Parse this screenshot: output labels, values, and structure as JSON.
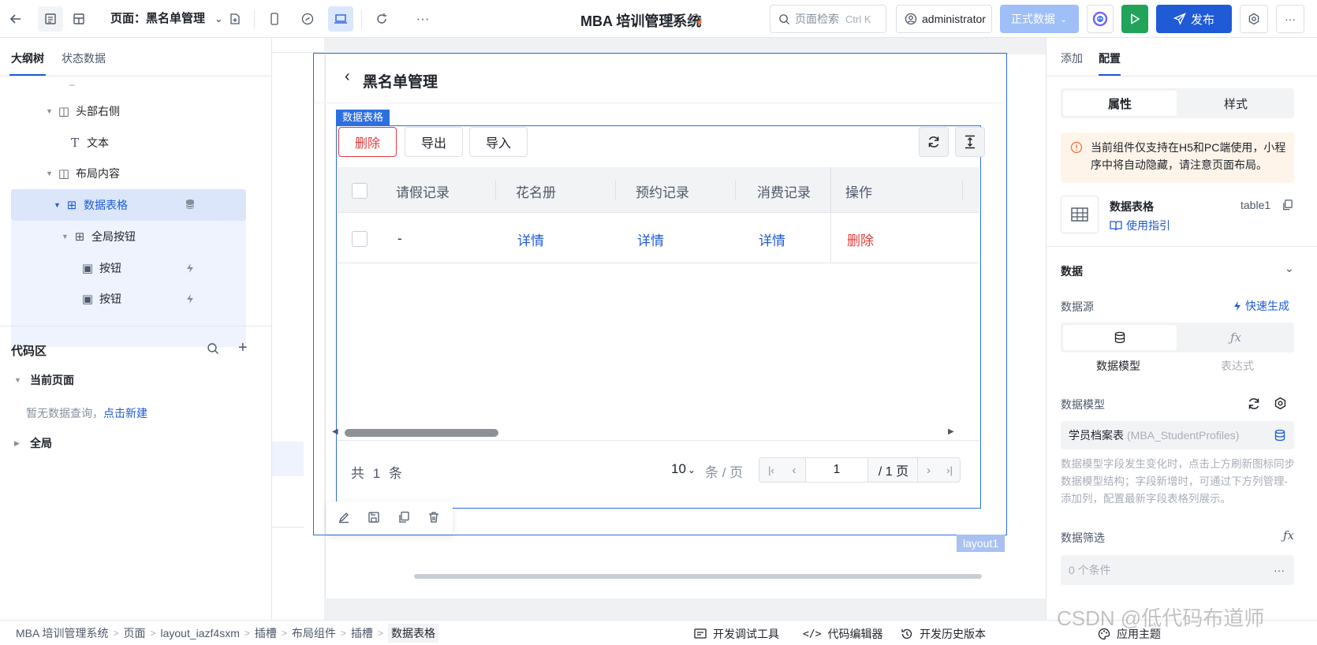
{
  "topbar": {
    "page_label": "页面：黑名单管理",
    "app_title": "MBA 培训管理系统",
    "search_placeholder": "页面检索",
    "search_shortcut": "Ctrl K",
    "user": "administrator",
    "env": "正式数据",
    "publish": "发布"
  },
  "left": {
    "tabs": [
      "大纲树",
      "状态数据"
    ],
    "tree": [
      {
        "label": "头部右侧"
      },
      {
        "label": "文本"
      },
      {
        "label": "布局内容"
      },
      {
        "label": "数据表格"
      },
      {
        "label": "全局按钮"
      },
      {
        "label": "按钮"
      },
      {
        "label": "按钮"
      }
    ],
    "code_area": "代码区",
    "current_page": "当前页面",
    "no_query": "暂无数据查询，",
    "create_new": "点击新建",
    "global": "全局"
  },
  "canvas": {
    "page_title": "黑名单管理",
    "table_tag": "数据表格",
    "btn_delete": "删除",
    "btn_export": "导出",
    "btn_import": "导入",
    "columns": [
      "请假记录",
      "花名册",
      "预约记录",
      "消费记录",
      "操作"
    ],
    "rows": [
      {
        "c1": "-",
        "c2": "详情",
        "c3": "详情",
        "c4": "详情",
        "op": "删除"
      }
    ],
    "total_prefix": "共",
    "total": "1",
    "total_suffix": "条",
    "page_size": "10",
    "per_page": "条 / 页",
    "page": "1",
    "page_total": "/ 1 页",
    "layout_tag": "layout1"
  },
  "right": {
    "tabs": [
      "添加",
      "配置"
    ],
    "subtabs": [
      "属性",
      "样式"
    ],
    "notice": "当前组件仅支持在H5和PC端使用，小程序中将自动隐藏，请注意页面布局。",
    "comp_name": "数据表格",
    "comp_id": "table1",
    "guide": "使用指引",
    "section_data": "数据",
    "datasource": "数据源",
    "quick_gen": "快速生成",
    "ds_model": "数据模型",
    "ds_expr": "表达式",
    "model_label": "数据模型",
    "model_value": "学员档案表",
    "model_code": "(MBA_StudentProfiles)",
    "model_hint": "数据模型字段发生变化时，点击上方刷新图标同步数据模型结构；字段新增时，可通过下方列管理-添加列，配置最新字段表格列展示。",
    "filter_label": "数据筛选",
    "filter_value": "0 个条件"
  },
  "statusbar": {
    "crumbs": [
      "MBA 培训管理系统",
      "页面",
      "layout_iazf4sxm",
      "插槽",
      "布局组件",
      "插槽",
      "数据表格"
    ],
    "dev_tools": "开发调试工具",
    "code_editor": "代码编辑器",
    "history": "开发历史版本",
    "theme": "应用主题",
    "watermark": "CSDN @低代码布道师"
  }
}
